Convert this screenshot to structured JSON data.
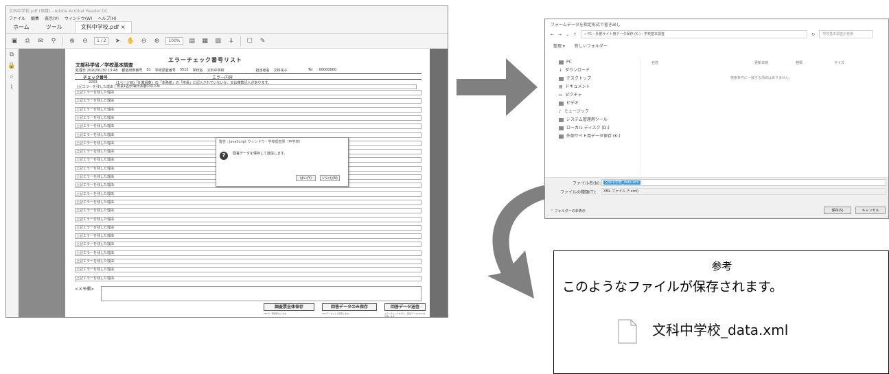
{
  "acrobat": {
    "title": "文科中学校.pdf (保護) - Adobe Acrobat Reader DC",
    "menus": [
      "ファイル",
      "編集",
      "表示(V)",
      "ウィンドウ(W)",
      "ヘルプ(H)"
    ],
    "tabs": [
      "ホーム",
      "ツール",
      "文科中学校.pdf"
    ],
    "page_indicator": "1 / 2",
    "zoom": "100%",
    "document": {
      "title": "エラーチェック番号リスト",
      "subtitle": "文部科学省／学校基本調査",
      "info": [
        "処理日 2020/01/30 13:48",
        "都道府県番号",
        "01",
        "学校調査番号",
        "3512",
        "学校名",
        "文科中学校",
        "担当者名",
        "文科花子",
        "Tel",
        ": 00000000"
      ],
      "col_check": "チェック番号",
      "col_error": "エラー内容",
      "first_code": "2203",
      "first_msg": "(1ページ目)「8 教員数」の「本務者」の「校長」に記入されていないか、又は複数記入があります。",
      "first_reason": "上記エラーを残した理由",
      "first_reason_val": "校長1名が海外派遣中のため",
      "row_label": "上記エラーを残した理由",
      "memo_label": "<メモ欄>",
      "buttons": [
        {
          "label": "調査票全体保存",
          "note": "PDFの一時保存をします。"
        },
        {
          "label": "回答データのみ保存",
          "note": "XMLデータとして保存します。"
        },
        {
          "label": "回答データ送信",
          "note": "エラーチェックを行い、回答データ(XML)を送信します。"
        }
      ]
    },
    "dialog": {
      "title": "警告 : JavaScript ウィンドウ - 学校調査票（中学校）",
      "message": "回答データを保存して送信します。",
      "yes": "はい(Y)",
      "no": "いいえ(N)"
    }
  },
  "save_dialog": {
    "title": "フォームデータを指定形式で書き出し",
    "path": "« PC › 外部サイト用データ保存 (K:) › 学校基本調査",
    "search_placeholder": "学校基本調査の検索",
    "organize": "整理 ▾",
    "new_folder": "新しいフォルダー",
    "nav_items": [
      "PC",
      "ダウンロード",
      "デスクトップ",
      "ドキュメント",
      "ピクチャ",
      "ビデオ",
      "ミュージック",
      "システム管理用ツール",
      "ローカル ディスク (D:)",
      "外部サイト用データ保存 (K:)"
    ],
    "columns": [
      "名前",
      "更新日時",
      "種類",
      "サイズ"
    ],
    "empty_msg": "検索条件に一致する項目はありません。",
    "filename_label": "ファイル名(N):",
    "filename_value": "文科中学校_data.xml",
    "filetype_label": "ファイルの種類(T):",
    "filetype_value": "XML ファイル (*.xml)",
    "hide_folders": "フォルダーの非表示",
    "save": "保存(S)",
    "cancel": "キャンセル"
  },
  "reference": {
    "title": "参考",
    "subtitle": "このようなファイルが保存されます。",
    "file_name": "文科中学校_data.xml"
  },
  "colors": {
    "arrow": "#808080",
    "dialog_highlight": "#3399ff"
  }
}
